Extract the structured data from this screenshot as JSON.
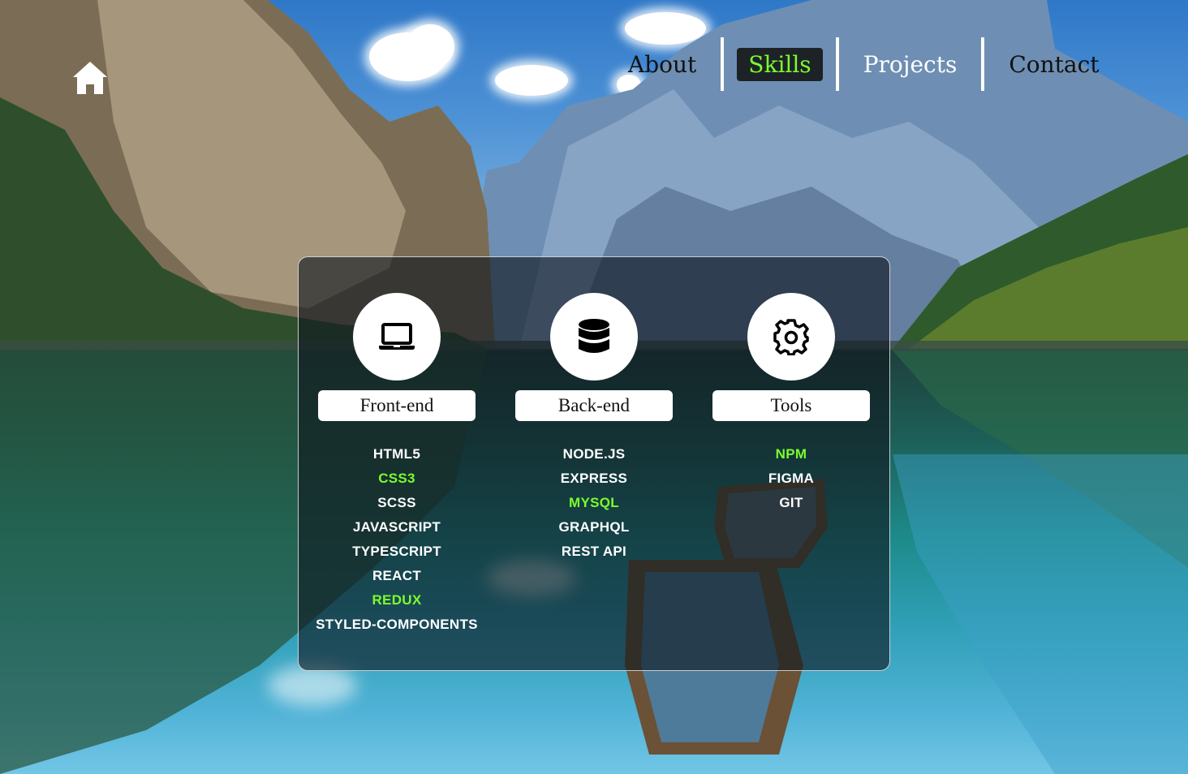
{
  "colors": {
    "accent": "#7cfc2f",
    "panel": "rgba(14,22,30,0.62)",
    "nav_active_bg": "#1d2227"
  },
  "home": {
    "icon": "home-icon"
  },
  "nav": {
    "items": [
      {
        "label": "About",
        "active": false
      },
      {
        "label": "Skills",
        "active": true
      },
      {
        "label": "Projects",
        "active": false
      },
      {
        "label": "Contact",
        "active": false
      }
    ]
  },
  "skills": {
    "columns": [
      {
        "icon": "laptop-icon",
        "title": "Front-end",
        "items": [
          "HTML5",
          "CSS3",
          "SCSS",
          "JAVASCRIPT",
          "TYPESCRIPT",
          "REACT",
          "REDUX",
          "STYLED-COMPONENTS"
        ],
        "highlighted": [
          "CSS3",
          "REDUX"
        ]
      },
      {
        "icon": "database-icon",
        "title": "Back-end",
        "items": [
          "NODE.JS",
          "EXPRESS",
          "MYSQL",
          "GRAPHQL",
          "REST API"
        ],
        "highlighted": [
          "MYSQL"
        ]
      },
      {
        "icon": "gear-icon",
        "title": "Tools",
        "items": [
          "NPM",
          "FIGMA",
          "GIT"
        ],
        "highlighted": [
          "NPM"
        ]
      }
    ]
  }
}
